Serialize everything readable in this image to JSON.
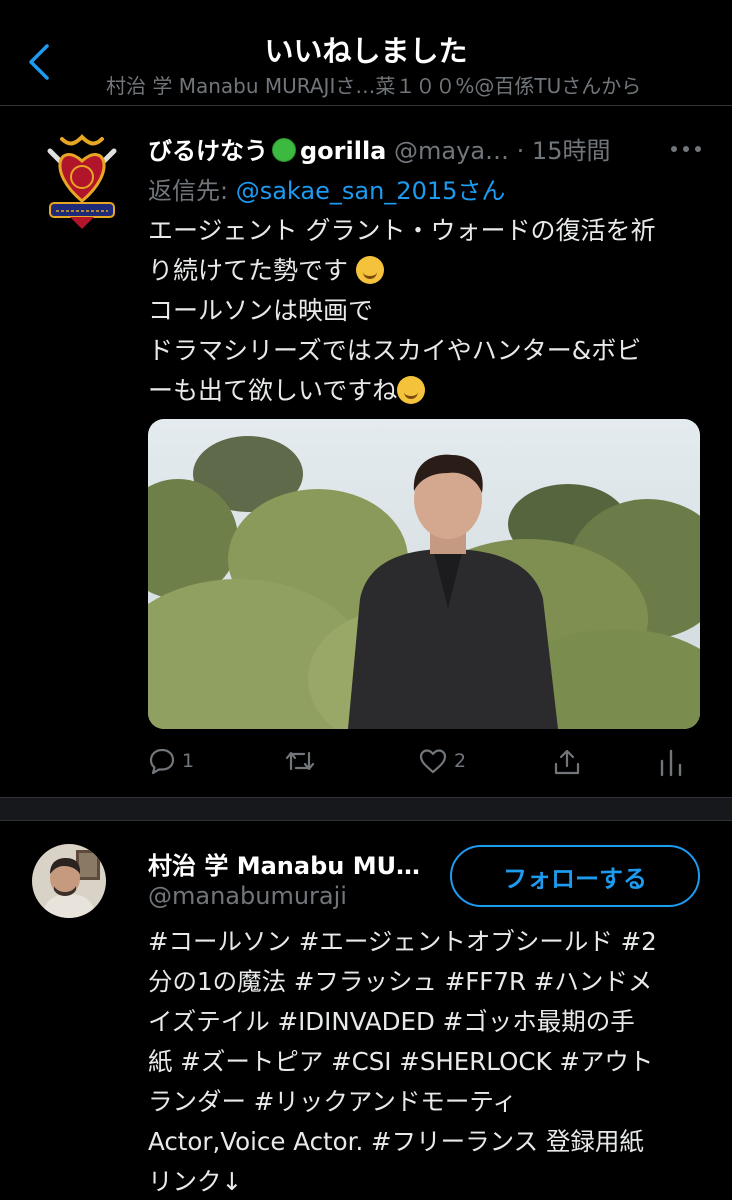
{
  "header": {
    "title": "いいねしました",
    "subtitle": "村治 学 Manabu MURAJIさ…菜１００%@百係TUさんから"
  },
  "tweet": {
    "name": "びるけなう",
    "name_suffix": "gorilla",
    "handle": "@maya…",
    "time": "· 15時間",
    "reply_prefix": "返信先: ",
    "reply_to": "@sakae_san_2015さん",
    "lines": [
      "エージェント グラント・ウォードの復活を祈",
      "り続けてた勢です",
      "コールソンは映画で",
      "ドラマシリーズではスカイやハンター&ボビ",
      "ーも出て欲しいですね"
    ],
    "reply_count": "1",
    "retweet_count": "",
    "like_count": "2",
    "icons": {
      "reply": "reply-icon",
      "retweet": "retweet-icon",
      "like": "heart-icon",
      "share": "share-icon",
      "analytics": "analytics-icon",
      "more": "more-icon"
    }
  },
  "user": {
    "name": "村治 学 Manabu MU…",
    "handle": "@manabumuraji",
    "follow_label": "フォローする",
    "bio_lines": [
      "#コールソン #エージェントオブシールド #2",
      "分の1の魔法 #フラッシュ #FF7R #ハンドメ",
      "イズテイル #IDINVADED #ゴッホ最期の手",
      "紙 #ズートピア #CSI #SHERLOCK #アウト",
      "ランダー #リックアンドモーティ",
      "Actor,Voice Actor. #フリーランス 登録用紙",
      "リンク↓"
    ]
  },
  "colors": {
    "background": "#000000",
    "accent": "#1d9bf0",
    "muted": "#71767b",
    "text": "#e7e9ea"
  }
}
